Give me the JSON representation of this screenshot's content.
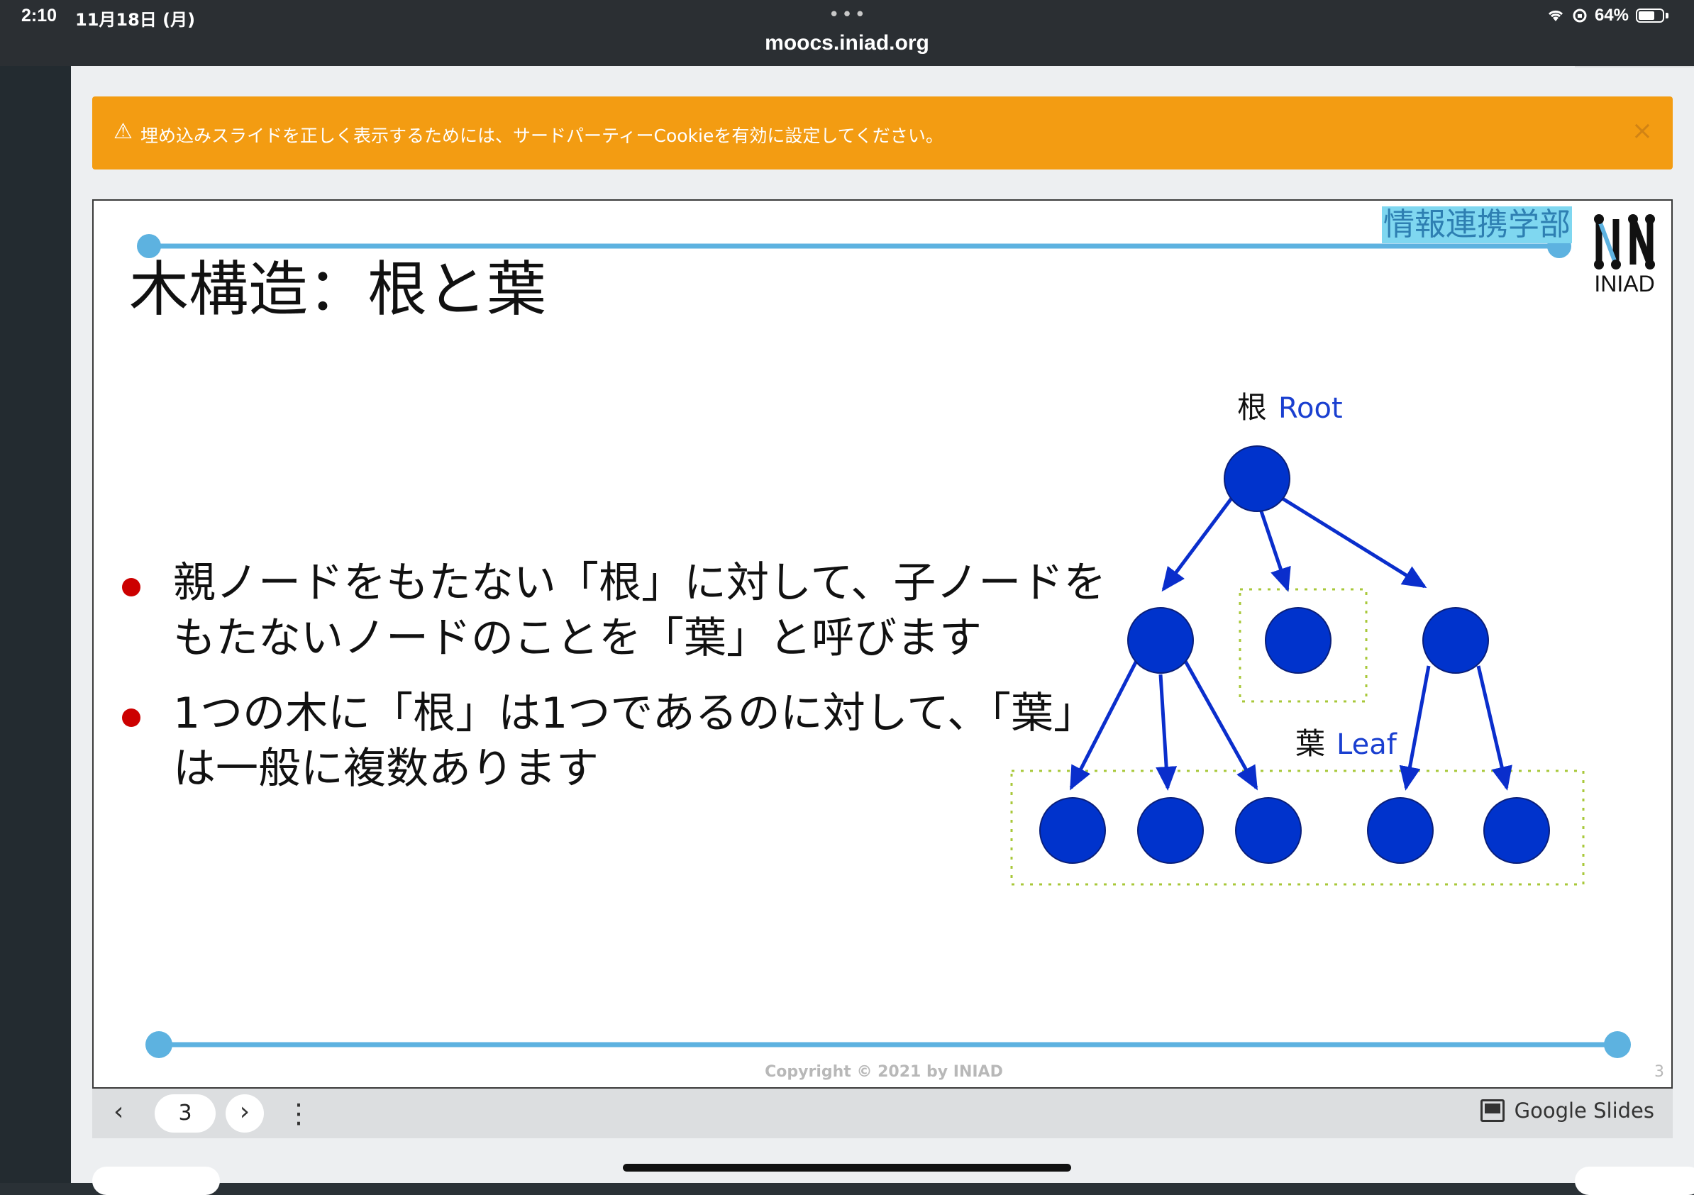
{
  "status": {
    "time": "2:10",
    "date": "11月18日 (月)",
    "battery": "64%",
    "url": "moocs.iniad.org",
    "dots": "•••"
  },
  "banner": {
    "icon": "warning-icon",
    "text": "埋め込みスライドを正しく表示するためには、サードパーティーCookieを有効に設定してください。",
    "close": "×"
  },
  "slide": {
    "title": "木構造：根と葉",
    "org_label": "情報連携学部",
    "logo_text": "INIAD",
    "bullets": [
      "親ノードをもたない「根」に対して、子ノードをもたないノードのことを「葉」と呼びます",
      "1つの木に「根」は1つであるのに対して、「葉」は一般に複数あります"
    ],
    "diagram": {
      "root_label_jp": "根",
      "root_label_en": "Root",
      "leaf_label_jp": "葉",
      "leaf_label_en": "Leaf"
    },
    "copyright": "Copyright © 2021 by INIAD",
    "page_number": "3"
  },
  "toolbar": {
    "prev": "‹",
    "page": "3",
    "next": "›",
    "more": "⋮",
    "brand": "Google Slides"
  },
  "colors": {
    "accent_line": "#5db2e0",
    "node_fill": "#0033cc",
    "leaf_box": "#a8c83a",
    "banner": "#f39c12",
    "bullet": "#cc0000"
  }
}
